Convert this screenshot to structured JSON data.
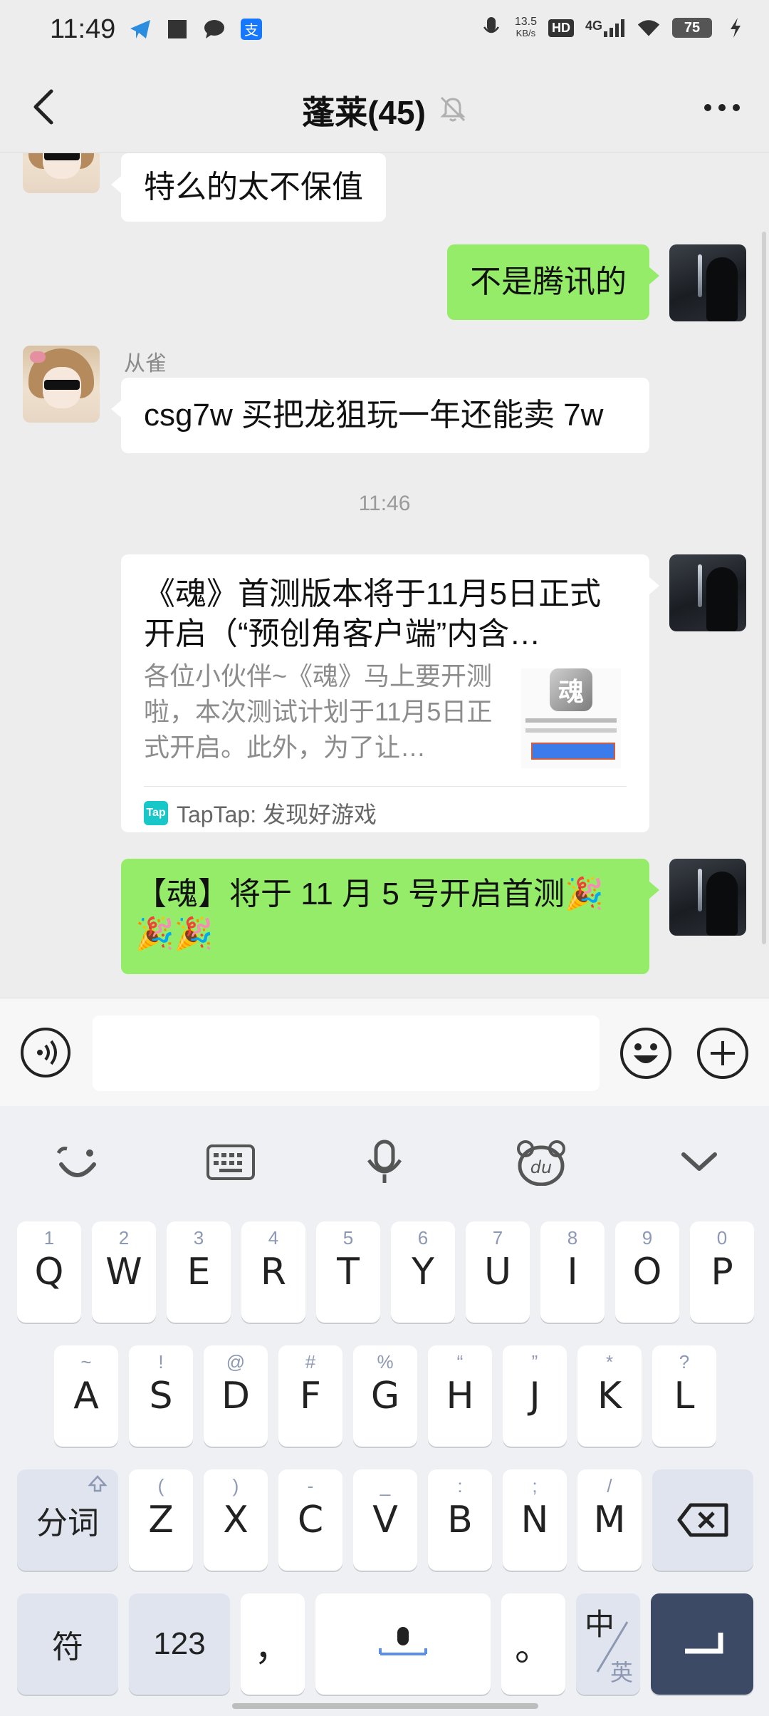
{
  "status_bar": {
    "time": "11:49",
    "net_speed_value": "13.5",
    "net_speed_unit": "KB/s",
    "hd": "HD",
    "network": "4G",
    "battery": "75",
    "icons": [
      "telegram-icon",
      "square-icon",
      "chat-bubble-icon",
      "alipay-icon",
      "mic-icon",
      "wifi-icon",
      "charging-icon"
    ]
  },
  "nav": {
    "title": "蓬莱(45)",
    "muted_icon": "bell-off-icon"
  },
  "messages": [
    {
      "side": "left",
      "text": "特么的太不保值"
    },
    {
      "side": "right",
      "text": "不是腾讯的"
    },
    {
      "side": "left",
      "sender": "从雀",
      "text": "csg7w 买把龙狙玩一年还能卖 7w"
    },
    {
      "type": "timestamp",
      "text": "11:46"
    },
    {
      "side": "right",
      "type": "link_card",
      "title": "《魂》首测版本将于11月5日正式开启（“预创角客户端”内含…",
      "description": "各位小伙伴~《魂》马上要开测啦，本次测试计划于11月5日正式开启。此外，为了让…",
      "thumb_logo": "魂",
      "source_logo": "Tap",
      "source": "TapTap: 发现好游戏"
    },
    {
      "side": "right",
      "text": "【魂】将于 11 月 5 号开启首测🎉🎉🎉"
    }
  ],
  "input_bar": {
    "voice_icon": "voice-icon",
    "emoji_icon": "emoji-icon",
    "plus_icon": "plus-icon",
    "value": ""
  },
  "keyboard": {
    "toolbar": [
      "smile-icon",
      "keyboard-icon",
      "mic-icon",
      "du-bear-icon",
      "collapse-chevron-icon"
    ],
    "row1": [
      {
        "main": "Q",
        "hint": "1"
      },
      {
        "main": "W",
        "hint": "2"
      },
      {
        "main": "E",
        "hint": "3"
      },
      {
        "main": "R",
        "hint": "4"
      },
      {
        "main": "T",
        "hint": "5"
      },
      {
        "main": "Y",
        "hint": "6"
      },
      {
        "main": "U",
        "hint": "7"
      },
      {
        "main": "I",
        "hint": "8"
      },
      {
        "main": "O",
        "hint": "9"
      },
      {
        "main": "P",
        "hint": "0"
      }
    ],
    "row2": [
      {
        "main": "A",
        "hint": "~"
      },
      {
        "main": "S",
        "hint": "!"
      },
      {
        "main": "D",
        "hint": "@"
      },
      {
        "main": "F",
        "hint": "#"
      },
      {
        "main": "G",
        "hint": "%"
      },
      {
        "main": "H",
        "hint": "“"
      },
      {
        "main": "J",
        "hint": "”"
      },
      {
        "main": "K",
        "hint": "*"
      },
      {
        "main": "L",
        "hint": "?"
      }
    ],
    "row3": [
      {
        "main": "Z",
        "hint": "("
      },
      {
        "main": "X",
        "hint": ")"
      },
      {
        "main": "C",
        "hint": "-"
      },
      {
        "main": "V",
        "hint": "_"
      },
      {
        "main": "B",
        "hint": ":"
      },
      {
        "main": "N",
        "hint": ";"
      },
      {
        "main": "M",
        "hint": "/"
      }
    ],
    "shift_label": "分词",
    "symbols_label": "符",
    "numbers_label": "123",
    "comma_label": "，",
    "period_label": "。",
    "lang_main": "中",
    "lang_alt": "英"
  }
}
